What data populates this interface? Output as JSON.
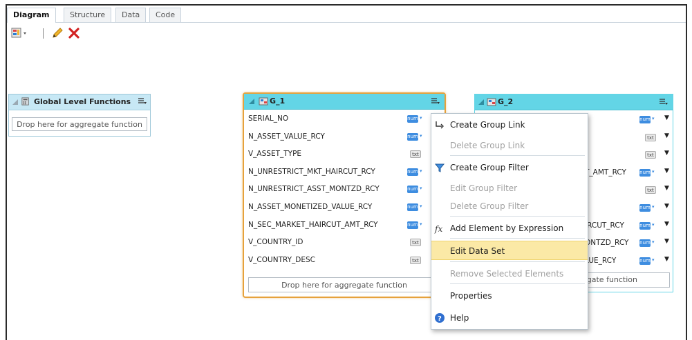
{
  "tabs": [
    {
      "label": "Diagram",
      "active": true
    },
    {
      "label": "Structure",
      "active": false
    },
    {
      "label": "Data",
      "active": false
    },
    {
      "label": "Code",
      "active": false
    }
  ],
  "toolbar": {
    "icons": [
      "add-dataset-icon",
      "edit-pencil-icon",
      "delete-x-icon"
    ]
  },
  "global_panel": {
    "title": "Global Level Functions",
    "drop_text": "Drop here for aggregate function"
  },
  "g1": {
    "title": "G_1",
    "fields": [
      {
        "name": "SERIAL_NO",
        "type": "num"
      },
      {
        "name": "N_ASSET_VALUE_RCY",
        "type": "num"
      },
      {
        "name": "V_ASSET_TYPE",
        "type": "txt"
      },
      {
        "name": "N_UNRESTRICT_MKT_HAIRCUT_RCY",
        "type": "num"
      },
      {
        "name": "N_UNRESTRICT_ASST_MONTZD_RCY",
        "type": "num"
      },
      {
        "name": "N_ASSET_MONETIZED_VALUE_RCY",
        "type": "num"
      },
      {
        "name": "N_SEC_MARKET_HAIRCUT_AMT_RCY",
        "type": "num"
      },
      {
        "name": "V_COUNTRY_ID",
        "type": "txt"
      },
      {
        "name": "V_COUNTRY_DESC",
        "type": "txt"
      }
    ],
    "drop_text": "Drop here for aggregate function"
  },
  "g2": {
    "title": "G_2",
    "rows": [
      {
        "fragment": "",
        "type": "num"
      },
      {
        "fragment": "",
        "type": "txt"
      },
      {
        "fragment": "",
        "type": "txt"
      },
      {
        "fragment": "T_AMT_RCY",
        "type": "num"
      },
      {
        "fragment": "",
        "type": "txt"
      },
      {
        "fragment": "",
        "type": "num"
      },
      {
        "fragment": "IRCUT_RCY",
        "type": "num"
      },
      {
        "fragment": "ONTZD_RCY",
        "type": "num"
      },
      {
        "fragment": "LUE_RCY",
        "type": "num"
      }
    ],
    "drop_text": "egate function"
  },
  "badge_labels": {
    "num": "num",
    "txt": "txt"
  },
  "context_menu": {
    "items": [
      {
        "label": "Create Group Link",
        "enabled": true,
        "icon": "group-link-icon"
      },
      {
        "label": "Delete Group Link",
        "enabled": false,
        "icon": ""
      },
      {
        "label": "Create Group Filter",
        "enabled": true,
        "icon": "filter-funnel-icon"
      },
      {
        "label": "Edit Group Filter",
        "enabled": false,
        "icon": ""
      },
      {
        "label": "Delete Group Filter",
        "enabled": false,
        "icon": ""
      },
      {
        "label": "Add Element by Expression",
        "enabled": true,
        "icon": "fx-expression-icon"
      },
      {
        "label": "Edit Data Set",
        "enabled": true,
        "icon": "",
        "highlighted": true
      },
      {
        "label": "Remove Selected Elements",
        "enabled": false,
        "icon": ""
      },
      {
        "label": "Properties",
        "enabled": true,
        "icon": ""
      },
      {
        "label": "Help",
        "enabled": true,
        "icon": "help-question-icon"
      }
    ]
  },
  "colors": {
    "accent_orange": "#e6a23c",
    "group_header": "#63d5e6",
    "menu_highlight": "#fbe9a6",
    "num_badge": "#3e8de0",
    "delete_red": "#d22222"
  }
}
